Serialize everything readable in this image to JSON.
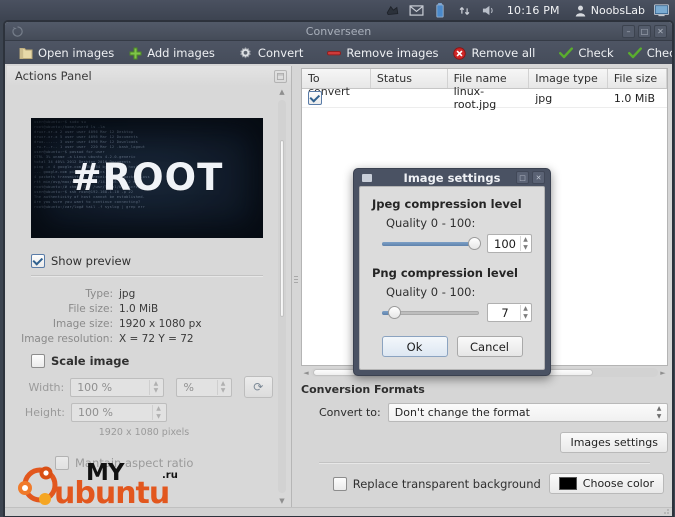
{
  "desktop": {
    "tray_icons": [
      "network-icon",
      "mail-icon",
      "battery-icon",
      "sync-icon",
      "volume-icon"
    ],
    "clock": "10:16 PM",
    "user": "NoobsLab",
    "session_icon": "display-icon"
  },
  "window": {
    "title": "Converseen",
    "spinner_icon": "loading-icon",
    "buttons": [
      {
        "name": "minimize-button",
        "glyph": "–"
      },
      {
        "name": "maximize-button",
        "glyph": "□"
      },
      {
        "name": "close-button",
        "glyph": "✕"
      }
    ]
  },
  "toolbar": {
    "items": [
      {
        "label": "Open images",
        "icon": "folder-icon"
      },
      {
        "label": "Add images",
        "icon": "plus-icon"
      },
      {
        "label": "Convert",
        "icon": "gear-icon"
      },
      {
        "label": "Remove images",
        "icon": "minus-icon"
      },
      {
        "label": "Remove all",
        "icon": "delete-circle-icon"
      },
      {
        "label": "Check",
        "icon": "check-icon"
      },
      {
        "label": "Check all",
        "icon": "check-icon"
      }
    ]
  },
  "actions_panel": {
    "title": "Actions Panel",
    "float_icon": "undock-icon",
    "preview": {
      "alt": "linux-root-preview",
      "headline": "#ROOT",
      "code_text": "user@ubuntu:~$ sudo su\nroot@ubuntu:/home/user# ls -la\ndrwxr-xr-x 2 user user 4096 Mar 12 Desktop\ndrwxr-xr-x 5 user user 4096 Mar 12 Documents\ndrwx------ 3 user user 4096 Mar 12 Downloads\n-rw-r--r-- 1 user user  220 Mar 12 .bash_logout\nuser@ubuntu:~$ passwd for user\nCTRL 3% uname -a Linux ubuntu 4.2.0-generic\ntotal 34 40%% 2012 Desktop 2016 Documents\nping -c 4 google.com PING 64 bytes from host\n--- google.com ping statistics ---\n4 packets transmitted, 4 received, 0% packet loss\nrtt min/avg/max/mdev = 12.3/14.1/16.0/1.2 ms\nroot@ubuntu:/# chmod 755 /usr/local/bin/script.sh\nuser@ubuntu:~$ ssh root@192.168.1.10 -p 22\nThe authenticity of host cannot be established.\nAre you sure you want to continue connecting?\nroot@ubuntu:/var/log# tail -f syslog | grep err"
    },
    "show_preview": {
      "label": "Show preview",
      "checked": true
    },
    "info": [
      {
        "key": "Type:",
        "value": "jpg"
      },
      {
        "key": "File size:",
        "value": "1.0 MiB"
      },
      {
        "key": "Image size:",
        "value": "1920 x 1080 px"
      },
      {
        "key": "Image resolution:",
        "value": "X = 72 Y = 72"
      }
    ],
    "scale_image": {
      "label": "Scale image",
      "checked": false
    },
    "width": {
      "label": "Width:",
      "value": "100 %"
    },
    "height": {
      "label": "Height:",
      "value": "100 %"
    },
    "unit": {
      "value": "%"
    },
    "reset_icon": "refresh-icon",
    "pixels_hint": "1920 x 1080 pixels",
    "aspect_ratio": {
      "label": "Mantain aspect ratio",
      "checked": true
    }
  },
  "watermark": {
    "line1": "MY",
    "line2": "ubuntu",
    "line3": ".ru",
    "logo": "ubuntu-logo-icon"
  },
  "file_list": {
    "columns": [
      "To convert",
      "Status",
      "File name",
      "Image type",
      "File size"
    ],
    "rows": [
      {
        "to_convert": true,
        "status": "",
        "file_name": "linux-root.jpg",
        "image_type": "jpg",
        "file_size": "1.0 MiB"
      }
    ]
  },
  "conversion": {
    "title": "Conversion Formats",
    "convert_to_label": "Convert to:",
    "convert_to_value": "Don't change the format",
    "images_settings_label": "Images settings",
    "replace_bg": {
      "label": "Replace transparent background",
      "checked": false
    },
    "choose_color_label": "Choose color",
    "choose_color_value": "#000000"
  },
  "dialog": {
    "title": "Image settings",
    "app_icon": "window-icon",
    "buttons": [
      {
        "name": "maximize-button",
        "glyph": "□"
      },
      {
        "name": "close-button",
        "glyph": "✕"
      }
    ],
    "jpeg": {
      "heading": "Jpeg compression level",
      "quality_label": "Quality 0 - 100:",
      "value": "100",
      "percent": 100
    },
    "png": {
      "heading": "Png compression level",
      "quality_label": "Quality 0 - 100:",
      "value": "7",
      "percent": 7
    },
    "ok_label": "Ok",
    "cancel_label": "Cancel"
  },
  "colors": {
    "accent": "#5e82ad",
    "panel_bg": "#d8d8d8",
    "titlebar": "#4b5260",
    "preview_bg": "#0d1520",
    "ubuntu_orange": "#e2571e"
  }
}
